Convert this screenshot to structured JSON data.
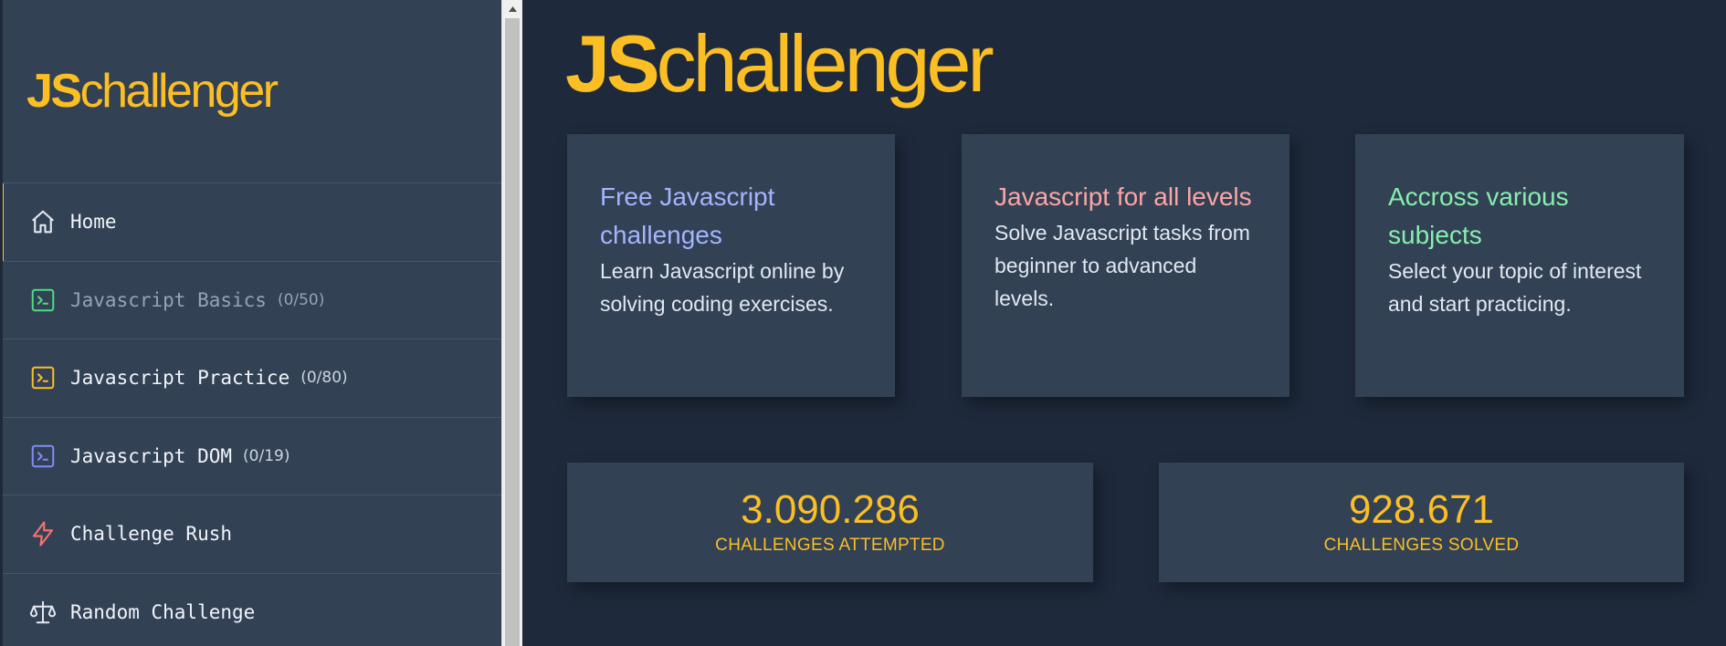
{
  "sidebar": {
    "logo": {
      "bold": "JS",
      "rest": "challenger"
    },
    "items": [
      {
        "label": "Home",
        "count": "",
        "icon": "home-icon",
        "icon_color": "#e2e8f0",
        "active": true
      },
      {
        "label": "Javascript Basics",
        "count": "(0/50)",
        "icon": "terminal-icon",
        "icon_color": "#4ade80",
        "muted": true
      },
      {
        "label": "Javascript Practice",
        "count": "(0/80)",
        "icon": "terminal-icon",
        "icon_color": "#fbbf24"
      },
      {
        "label": "Javascript DOM",
        "count": "(0/19)",
        "icon": "terminal-icon",
        "icon_color": "#818cf8"
      },
      {
        "label": "Challenge Rush",
        "count": "",
        "icon": "lightning-icon",
        "icon_color": "#f87171"
      },
      {
        "label": "Random Challenge",
        "count": "",
        "icon": "scale-icon",
        "icon_color": "#e2e8f0"
      }
    ]
  },
  "main": {
    "logo": {
      "bold": "JS",
      "rest": "challenger"
    },
    "cards": [
      {
        "title": "Free Javascript challenges",
        "title_color": "#a5b4fc",
        "text": "Learn Javascript online by solving coding exercises."
      },
      {
        "title": "Javascript for all levels",
        "title_color": "#fca5a5",
        "text": "Solve Javascript tasks from beginner to advanced levels."
      },
      {
        "title": "Accross various subjects",
        "title_color": "#86efac",
        "text": "Select your topic of interest and start practicing."
      }
    ],
    "stats": [
      {
        "value": "3.090.286",
        "label": "CHALLENGES ATTEMPTED"
      },
      {
        "value": "928.671",
        "label": "CHALLENGES SOLVED"
      }
    ]
  },
  "colors": {
    "accent": "#fbbf24",
    "bg": "#1e293b",
    "panel": "#334155"
  }
}
